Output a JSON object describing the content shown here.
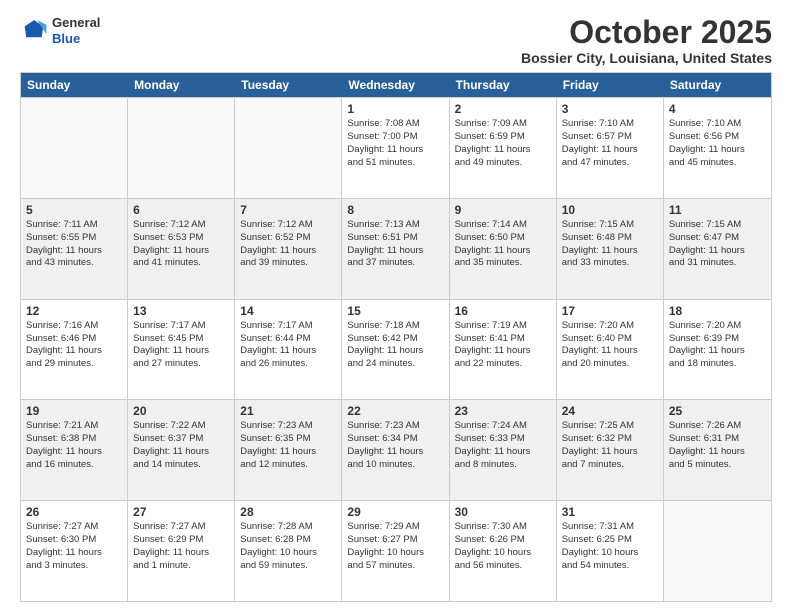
{
  "header": {
    "logo": {
      "general": "General",
      "blue": "Blue"
    },
    "month_year": "October 2025",
    "location": "Bossier City, Louisiana, United States"
  },
  "days_of_week": [
    "Sunday",
    "Monday",
    "Tuesday",
    "Wednesday",
    "Thursday",
    "Friday",
    "Saturday"
  ],
  "weeks": [
    [
      {
        "day": "",
        "info": ""
      },
      {
        "day": "",
        "info": ""
      },
      {
        "day": "",
        "info": ""
      },
      {
        "day": "1",
        "info": "Sunrise: 7:08 AM\nSunset: 7:00 PM\nDaylight: 11 hours\nand 51 minutes."
      },
      {
        "day": "2",
        "info": "Sunrise: 7:09 AM\nSunset: 6:59 PM\nDaylight: 11 hours\nand 49 minutes."
      },
      {
        "day": "3",
        "info": "Sunrise: 7:10 AM\nSunset: 6:57 PM\nDaylight: 11 hours\nand 47 minutes."
      },
      {
        "day": "4",
        "info": "Sunrise: 7:10 AM\nSunset: 6:56 PM\nDaylight: 11 hours\nand 45 minutes."
      }
    ],
    [
      {
        "day": "5",
        "info": "Sunrise: 7:11 AM\nSunset: 6:55 PM\nDaylight: 11 hours\nand 43 minutes."
      },
      {
        "day": "6",
        "info": "Sunrise: 7:12 AM\nSunset: 6:53 PM\nDaylight: 11 hours\nand 41 minutes."
      },
      {
        "day": "7",
        "info": "Sunrise: 7:12 AM\nSunset: 6:52 PM\nDaylight: 11 hours\nand 39 minutes."
      },
      {
        "day": "8",
        "info": "Sunrise: 7:13 AM\nSunset: 6:51 PM\nDaylight: 11 hours\nand 37 minutes."
      },
      {
        "day": "9",
        "info": "Sunrise: 7:14 AM\nSunset: 6:50 PM\nDaylight: 11 hours\nand 35 minutes."
      },
      {
        "day": "10",
        "info": "Sunrise: 7:15 AM\nSunset: 6:48 PM\nDaylight: 11 hours\nand 33 minutes."
      },
      {
        "day": "11",
        "info": "Sunrise: 7:15 AM\nSunset: 6:47 PM\nDaylight: 11 hours\nand 31 minutes."
      }
    ],
    [
      {
        "day": "12",
        "info": "Sunrise: 7:16 AM\nSunset: 6:46 PM\nDaylight: 11 hours\nand 29 minutes."
      },
      {
        "day": "13",
        "info": "Sunrise: 7:17 AM\nSunset: 6:45 PM\nDaylight: 11 hours\nand 27 minutes."
      },
      {
        "day": "14",
        "info": "Sunrise: 7:17 AM\nSunset: 6:44 PM\nDaylight: 11 hours\nand 26 minutes."
      },
      {
        "day": "15",
        "info": "Sunrise: 7:18 AM\nSunset: 6:42 PM\nDaylight: 11 hours\nand 24 minutes."
      },
      {
        "day": "16",
        "info": "Sunrise: 7:19 AM\nSunset: 6:41 PM\nDaylight: 11 hours\nand 22 minutes."
      },
      {
        "day": "17",
        "info": "Sunrise: 7:20 AM\nSunset: 6:40 PM\nDaylight: 11 hours\nand 20 minutes."
      },
      {
        "day": "18",
        "info": "Sunrise: 7:20 AM\nSunset: 6:39 PM\nDaylight: 11 hours\nand 18 minutes."
      }
    ],
    [
      {
        "day": "19",
        "info": "Sunrise: 7:21 AM\nSunset: 6:38 PM\nDaylight: 11 hours\nand 16 minutes."
      },
      {
        "day": "20",
        "info": "Sunrise: 7:22 AM\nSunset: 6:37 PM\nDaylight: 11 hours\nand 14 minutes."
      },
      {
        "day": "21",
        "info": "Sunrise: 7:23 AM\nSunset: 6:35 PM\nDaylight: 11 hours\nand 12 minutes."
      },
      {
        "day": "22",
        "info": "Sunrise: 7:23 AM\nSunset: 6:34 PM\nDaylight: 11 hours\nand 10 minutes."
      },
      {
        "day": "23",
        "info": "Sunrise: 7:24 AM\nSunset: 6:33 PM\nDaylight: 11 hours\nand 8 minutes."
      },
      {
        "day": "24",
        "info": "Sunrise: 7:25 AM\nSunset: 6:32 PM\nDaylight: 11 hours\nand 7 minutes."
      },
      {
        "day": "25",
        "info": "Sunrise: 7:26 AM\nSunset: 6:31 PM\nDaylight: 11 hours\nand 5 minutes."
      }
    ],
    [
      {
        "day": "26",
        "info": "Sunrise: 7:27 AM\nSunset: 6:30 PM\nDaylight: 11 hours\nand 3 minutes."
      },
      {
        "day": "27",
        "info": "Sunrise: 7:27 AM\nSunset: 6:29 PM\nDaylight: 11 hours\nand 1 minute."
      },
      {
        "day": "28",
        "info": "Sunrise: 7:28 AM\nSunset: 6:28 PM\nDaylight: 10 hours\nand 59 minutes."
      },
      {
        "day": "29",
        "info": "Sunrise: 7:29 AM\nSunset: 6:27 PM\nDaylight: 10 hours\nand 57 minutes."
      },
      {
        "day": "30",
        "info": "Sunrise: 7:30 AM\nSunset: 6:26 PM\nDaylight: 10 hours\nand 56 minutes."
      },
      {
        "day": "31",
        "info": "Sunrise: 7:31 AM\nSunset: 6:25 PM\nDaylight: 10 hours\nand 54 minutes."
      },
      {
        "day": "",
        "info": ""
      }
    ]
  ]
}
